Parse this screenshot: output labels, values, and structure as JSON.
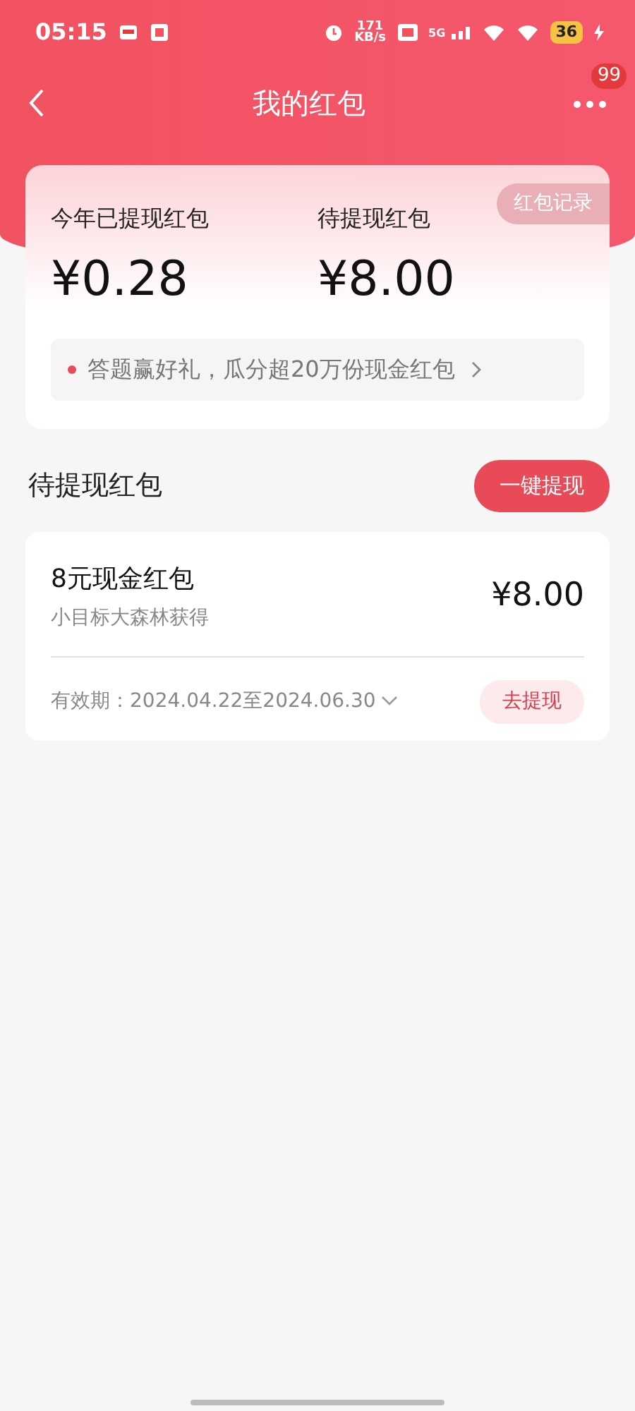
{
  "status_bar": {
    "time": "05:15",
    "net_speed": "171",
    "net_unit": "KB/s",
    "network": "5G",
    "battery": "36"
  },
  "header": {
    "title": "我的红包",
    "badge": "99"
  },
  "summary": {
    "withdrawn_label": "今年已提现红包",
    "withdrawn_amount": "¥0.28",
    "pending_label": "待提现红包",
    "pending_amount": "¥8.00",
    "record_button": "红包记录",
    "promo": "答题赢好礼，瓜分超20万份现金红包"
  },
  "section": {
    "title": "待提现红包",
    "button": "一键提现"
  },
  "packets": [
    {
      "name": "8元现金红包",
      "source": "小目标大森林获得",
      "amount": "¥8.00",
      "validity": "有效期：2024.04.22至2024.06.30",
      "action": "去提现"
    }
  ]
}
